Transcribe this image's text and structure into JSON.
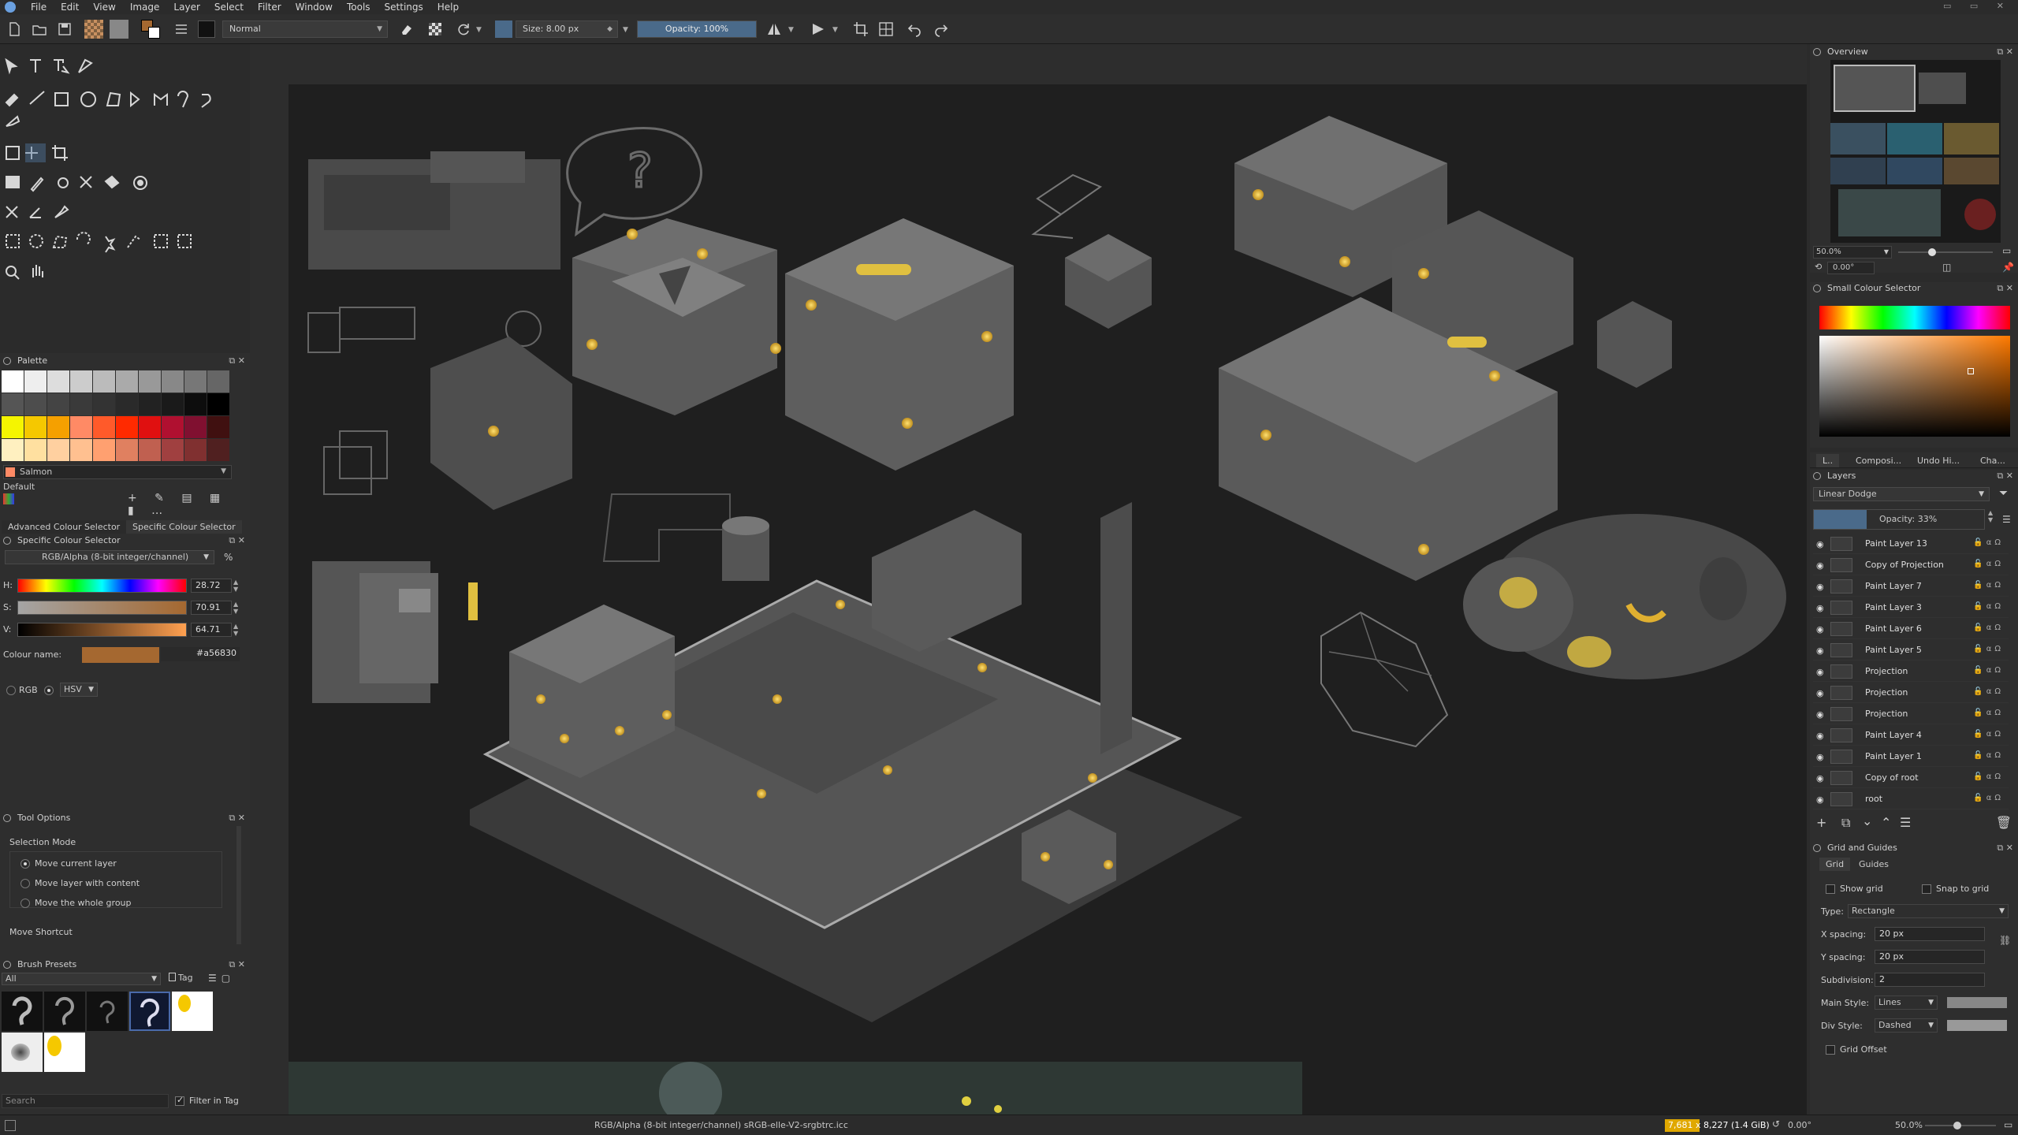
{
  "menu": [
    "File",
    "Edit",
    "View",
    "Image",
    "Layer",
    "Select",
    "Filter",
    "Window",
    "Tools",
    "Settings",
    "Help"
  ],
  "toolbar": {
    "blend_mode": "Normal",
    "size": "Size: 8.00 px",
    "opacity": "Opacity: 100%"
  },
  "palette": {
    "title": "Palette",
    "selected_name": "Salmon",
    "set_name": "Default",
    "colors": [
      "#ffffff",
      "#eeeeee",
      "#dddddd",
      "#cccccc",
      "#bbbbbb",
      "#aaaaaa",
      "#999999",
      "#888888",
      "#777777",
      "#666666",
      "#555555",
      "#4d4d4d",
      "#444444",
      "#3a3a3a",
      "#333333",
      "#2a2a2a",
      "#222222",
      "#1a1a1a",
      "#0d0d0d",
      "#000000",
      "#f5f500",
      "#f5c800",
      "#f5a000",
      "#ff8a65",
      "#ff5a2a",
      "#ff2a00",
      "#e01010",
      "#b01030",
      "#801030",
      "#401010",
      "#fff0c0",
      "#ffe0a0",
      "#ffd0a0",
      "#ffc090",
      "#ffa070",
      "#e08060",
      "#c06050",
      "#a04040",
      "#803030",
      "#502020"
    ]
  },
  "colour_tabs": [
    "Advanced Colour Selector",
    "Specific Colour Selector"
  ],
  "specific_colour": {
    "title": "Specific Colour Selector",
    "model": "RGB/Alpha (8-bit integer/channel)",
    "percent": "%",
    "h_label": "H:",
    "h": "28.72",
    "s_label": "S:",
    "s": "70.91",
    "v_label": "V:",
    "v": "64.71",
    "name_label": "Colour name:",
    "hex": "#a56830",
    "rgb_label": "RGB",
    "hsv_label": "HSV"
  },
  "tool_options": {
    "title": "Tool Options",
    "selection_mode": "Selection Mode",
    "opt1": "Move current layer",
    "opt2": "Move layer with content",
    "opt3": "Move the whole group",
    "shortcut": "Move Shortcut"
  },
  "brush_presets": {
    "title": "Brush Presets",
    "filter": "All",
    "tag": "Tag",
    "search": "Search",
    "filter_in_tag": "Filter in Tag"
  },
  "overview": {
    "title": "Overview",
    "zoom": "50.0%",
    "rotation": "0.00°"
  },
  "small_colour": {
    "title": "Small Colour Selector"
  },
  "docker_tabs": [
    "L..",
    "Composi...",
    "Undo Hi...",
    "Cha..."
  ],
  "layers": {
    "title": "Layers",
    "blend": "Linear Dodge",
    "opacity": "Opacity: 33%",
    "items": [
      "Paint Layer 13",
      "Copy of Projection",
      "Paint Layer 7",
      "Paint Layer 3",
      "Paint Layer 6",
      "Paint Layer 5",
      "Projection",
      "Projection",
      "Projection",
      "Paint Layer 4",
      "Paint Layer 1",
      "Copy of root",
      "root"
    ]
  },
  "grid": {
    "title": "Grid and Guides",
    "tabs": [
      "Grid",
      "Guides"
    ],
    "show_grid": "Show grid",
    "snap": "Snap to grid",
    "type_label": "Type:",
    "type": "Rectangle",
    "xs_label": "X spacing:",
    "xs": "20 px",
    "ys_label": "Y spacing:",
    "ys": "20 px",
    "sub_label": "Subdivision:",
    "sub": "2",
    "main_label": "Main Style:",
    "main": "Lines",
    "div_label": "Div Style:",
    "div": "Dashed",
    "offset": "Grid Offset"
  },
  "status": {
    "color_info": "RGB/Alpha (8-bit integer/channel)  sRGB-elle-V2-srgbtrc.icc",
    "dims": "7,681 x 8,227 (1.4 GiB)",
    "rotation": "0.00°",
    "zoom": "50.0%"
  },
  "colors": {
    "fg": "#a56830",
    "accent": "#4a6a8a"
  }
}
